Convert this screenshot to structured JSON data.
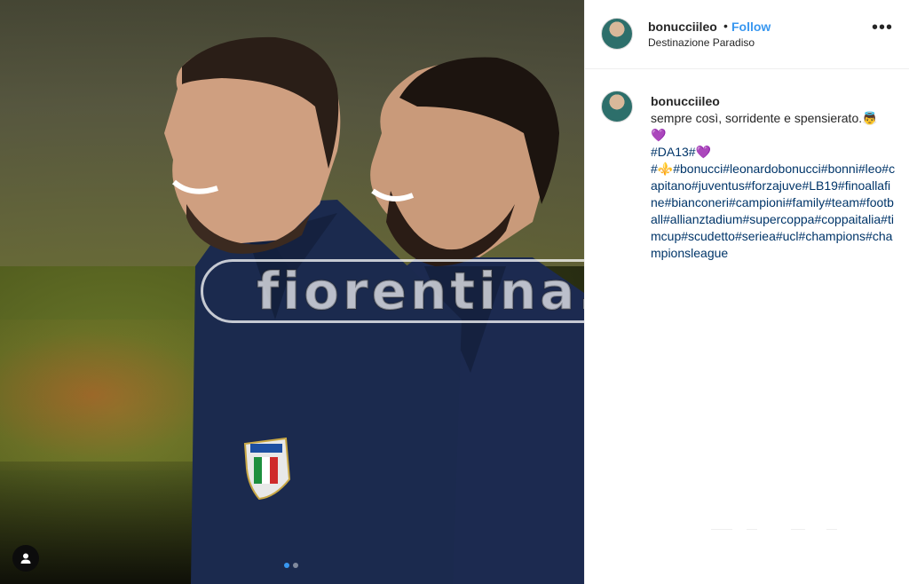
{
  "post": {
    "username": "bonucciileo",
    "separator": "•",
    "follow_label": "Follow",
    "location": "Destinazione Paradiso",
    "more_icon": "more-horizontal-icon",
    "carousel": {
      "count": 2,
      "active_index": 0
    }
  },
  "watermark": {
    "text": "fiorentina.it"
  },
  "caption": {
    "username": "bonucciileo",
    "text": "sempre così, sorridente e spensierato.👼",
    "heart_1": "💜",
    "tag_line_1": "#DA13#",
    "heart_2": "💜",
    "hashtags": "#⚜️#bonucci#leonardobonucci#bonni#leo#capitano#juventus#forzajuve#LB19#finoallafine#bianconeri#campioni#family#team#football#allianztadium#supercoppa#coppaitalia#timcup#scudetto#seriea#ucl#champions#championsleague"
  },
  "colors": {
    "link": "#3897f0",
    "hashtag": "#003569",
    "text": "#262626",
    "jacket": "#1b2a4e"
  }
}
